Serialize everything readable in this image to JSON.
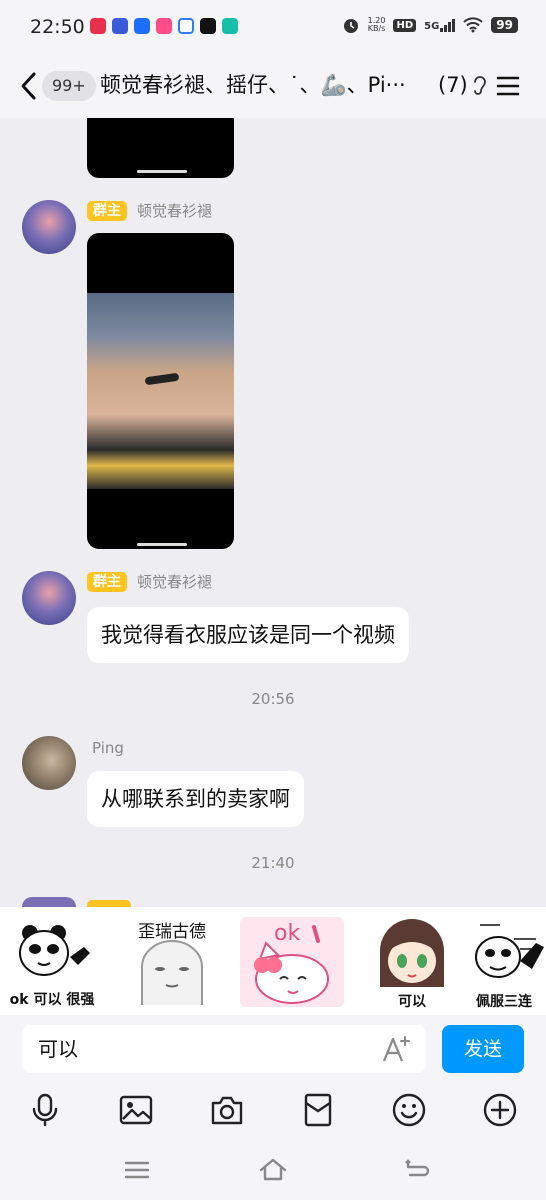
{
  "status_bar": {
    "time": "22:50",
    "net_speed_value": "1.20",
    "net_speed_unit": "KB/s",
    "hd": "HD",
    "signal": "5G",
    "battery": "99"
  },
  "header": {
    "unread_count": "99+",
    "title": "顿觉春衫褪、摇仔、˙、🦾、Pi···",
    "member_count": "(7)"
  },
  "messages": [
    {
      "badge": "群主",
      "sender": "顿觉春衫褪"
    },
    {
      "badge": "群主",
      "sender": "顿觉春衫褪",
      "text": "我觉得看衣服应该是同一个视频"
    },
    {
      "time": "20:56"
    },
    {
      "sender": "Ping",
      "text": "从哪联系到的卖家啊"
    },
    {
      "time": "21:40"
    }
  ],
  "stickers": [
    {
      "caption": "ok 可以 很强"
    },
    {
      "caption": "歪瑞古德"
    },
    {
      "caption": "ok"
    },
    {
      "caption": "可以"
    },
    {
      "caption": "佩服三连"
    }
  ],
  "input": {
    "value": "可以",
    "send_label": "发送"
  },
  "colors": {
    "accent": "#0099ff",
    "owner_badge": "#ffc41f",
    "background": "#eeeef2"
  }
}
